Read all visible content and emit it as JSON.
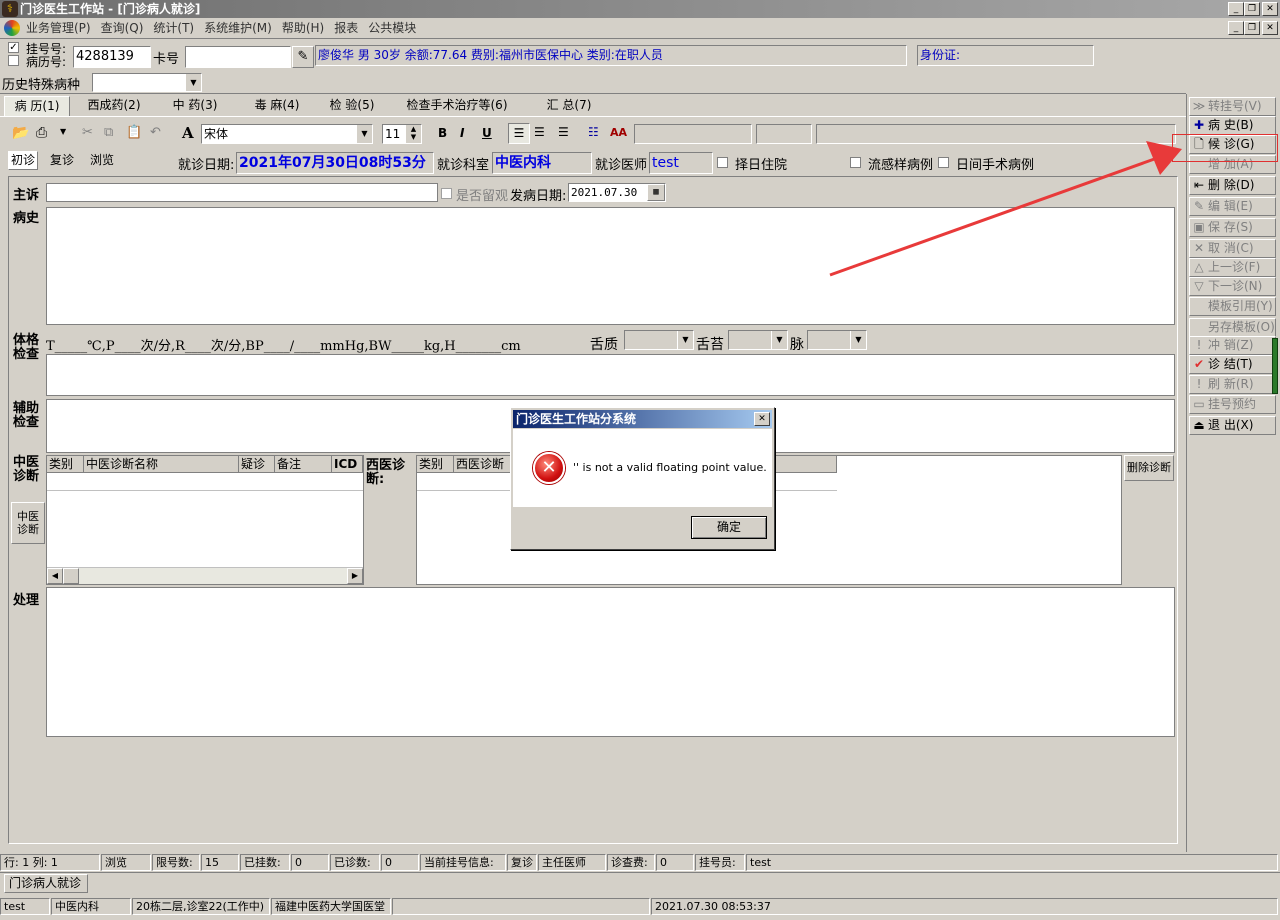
{
  "window": {
    "title": "门诊医生工作站 - [门诊病人就诊]"
  },
  "menu": [
    "业务管理(P)",
    "查询(Q)",
    "统计(T)",
    "系统维护(M)",
    "帮助(H)",
    "报表",
    "公共模块"
  ],
  "patient": {
    "reg_no_label": "挂号号:",
    "record_no_label": "病历号:",
    "reg_no_value": "4288139",
    "card_label": "卡号",
    "card_value": "",
    "info": "廖俊华 男 30岁 余额:77.64 费别:福州市医保中心 类别:在职人员",
    "id_label": "身份证:",
    "history_label": "历史特殊病种"
  },
  "tabs": [
    "病 历(1)",
    "西成药(2)",
    "中 药(3)",
    "毒 麻(4)",
    "检 验(5)",
    "检查手术治疗等(6)",
    "汇 总(7)"
  ],
  "toolbar": {
    "font_name": "宋体",
    "font_size": "11",
    "bold": "B",
    "italic": "I",
    "underline": "U",
    "aa": "AA"
  },
  "subtabs": [
    "初诊",
    "复诊",
    "浏览"
  ],
  "visit": {
    "date_label": "就诊日期:",
    "date_value": "2021年07月30日08时53分",
    "dept_label": "就诊科室",
    "dept_value": "中医内科",
    "doctor_label": "就诊医师",
    "doctor_value": "test",
    "hospitalize": "择日住院",
    "flu": "流感样病例",
    "daysurgery": "日间手术病例"
  },
  "form": {
    "complaint": "主诉",
    "observe": "是否留观",
    "onset_label": "发病日期:",
    "onset_value": "2021.07.30",
    "history": "病史",
    "exam": "体格检查",
    "exam_template": "T_____℃,P____次/分,R____次/分,BP____/____mmHg,BW_____kg,H_______cm",
    "tongue": "舌质",
    "coating": "舌苔",
    "pulse": "脉",
    "aux": "辅助检查",
    "tcm_dx": "中医诊断",
    "tcm_btn": "中医诊断",
    "west_dx": "西医诊断:",
    "del_dx": "删除诊断",
    "treat": "处理",
    "tcm_cols": [
      "类别",
      "中医诊断名称",
      "疑诊",
      "备注",
      "ICD码"
    ],
    "west_cols": [
      "类别",
      "西医诊断"
    ]
  },
  "side": [
    {
      "label": "转挂号(V)",
      "icon": "≫",
      "en": false
    },
    {
      "label": "病 史(B)",
      "icon": "✚",
      "en": true
    },
    {
      "label": "候 诊(G)",
      "icon": "🗋",
      "en": true
    },
    {
      "label": "增 加(A)",
      "icon": "",
      "en": false
    },
    {
      "label": "删 除(D)",
      "icon": "⇤",
      "en": true
    },
    {
      "label": "编 辑(E)",
      "icon": "✎",
      "en": false
    },
    {
      "label": "保 存(S)",
      "icon": "▣",
      "en": false
    },
    {
      "label": "取 消(C)",
      "icon": "✕",
      "en": false
    },
    {
      "label": "上一诊(F)",
      "icon": "△",
      "en": false
    },
    {
      "label": "下一诊(N)",
      "icon": "▽",
      "en": false
    },
    {
      "label": "模板引用(Y)",
      "icon": "",
      "en": false
    },
    {
      "label": "另存模板(O)",
      "icon": "",
      "en": false
    },
    {
      "label": "冲 销(Z)",
      "icon": "!",
      "en": false
    },
    {
      "label": "诊 结(T)",
      "icon": "✔",
      "en": true
    },
    {
      "label": "刷 新(R)",
      "icon": "!",
      "en": false
    },
    {
      "label": "挂号预约",
      "icon": "▭",
      "en": false
    },
    {
      "label": "退 出(X)",
      "icon": "⏏",
      "en": true
    }
  ],
  "dialog": {
    "title": "门诊医生工作站分系统",
    "message": "'' is not a valid floating point value.",
    "ok": "确定"
  },
  "status": {
    "row_col": "行: 1 列: 1",
    "mode": "浏览",
    "limit_label": "限号数:",
    "limit": "15",
    "reg_label": "已挂数:",
    "reg": "0",
    "seen_label": "已诊数:",
    "seen": "0",
    "cur_label": "当前挂号信息:",
    "cur_type": "复诊",
    "cur_doc": "主任医师",
    "fee_label": "诊查费:",
    "fee": "0",
    "op_label": "挂号员:",
    "op": "test"
  },
  "bottom_tab": "门诊病人就诊",
  "footer": {
    "user": "test",
    "dept": "中医内科",
    "room": "20栋二层,诊室22(工作中)",
    "org": "福建中医药大学国医堂",
    "time": "2021.07.30 08:53:37"
  },
  "colors": {
    "accent": "#0000c0",
    "highlight": "#e03030"
  }
}
